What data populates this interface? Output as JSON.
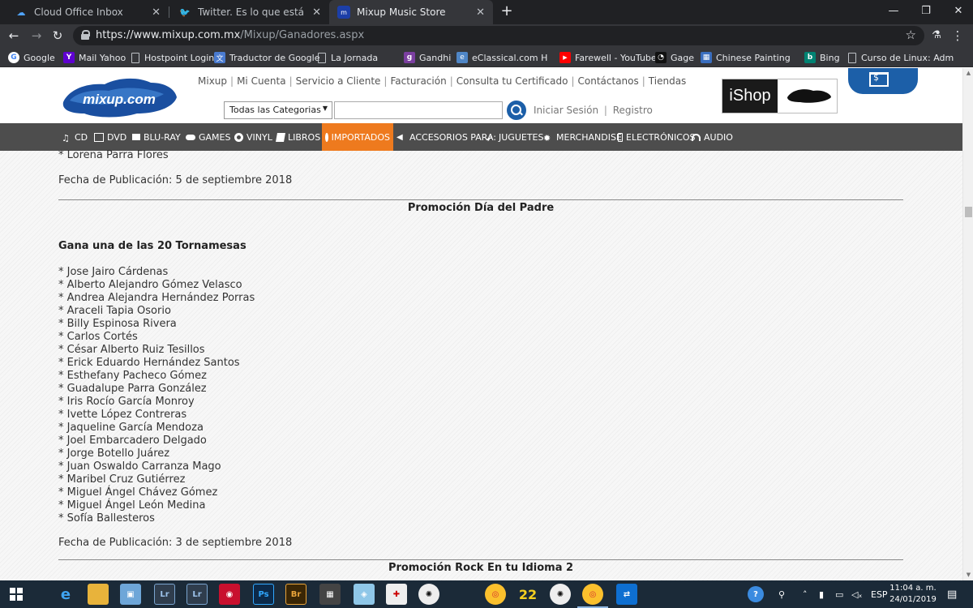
{
  "browser": {
    "tabs": [
      {
        "title": "Cloud Office Inbox",
        "icon": "cloud-icon",
        "active": false
      },
      {
        "title": "Twitter. Es lo que está pasando.",
        "icon": "twitter-icon",
        "active": false
      },
      {
        "title": "Mixup Music Store",
        "icon": "mixup-icon",
        "active": true
      }
    ],
    "url_host": "https://www.mixup.com.mx",
    "url_path": "/Mixup/Ganadores.aspx",
    "bookmarks": [
      {
        "label": "Google",
        "icon": "google-icon",
        "color": "#4285f4"
      },
      {
        "label": "Mail Yahoo",
        "icon": "yahoo-icon",
        "color": "#5f01d1"
      },
      {
        "label": "Hostpoint Login",
        "icon": "document-icon",
        "color": ""
      },
      {
        "label": "Traductor de Google",
        "icon": "translate-icon",
        "color": "#4a7bd0"
      },
      {
        "label": "La Jornada",
        "icon": "document-icon",
        "color": ""
      },
      {
        "label": "Gandhi",
        "icon": "gandhi-icon",
        "color": "#7b3fa0"
      },
      {
        "label": "eClassical.com High F",
        "icon": "eclassical-icon",
        "color": "#4f86c6"
      },
      {
        "label": "Farewell - YouTube",
        "icon": "youtube-icon",
        "color": "#ff0000"
      },
      {
        "label": "Gage",
        "icon": "gage-icon",
        "color": "#222"
      },
      {
        "label": "Chinese Painting Rice",
        "icon": "painting-icon",
        "color": "#3a6ebf"
      },
      {
        "label": "Bing",
        "icon": "bing-icon",
        "color": "#008373"
      },
      {
        "label": "Curso de Linux: Adm",
        "icon": "document-icon",
        "color": ""
      }
    ]
  },
  "site": {
    "logo_text": "mixup.com",
    "top_links": [
      "Mixup",
      "Mi Cuenta",
      "Servicio a Cliente",
      "Facturación",
      "Consulta tu Certificado",
      "Contáctanos",
      "Tiendas"
    ],
    "category_select": "Todas las Categorias",
    "search_placeholder": "",
    "login": "Iniciar Sesión",
    "register": "Registro",
    "ishop": "iShop",
    "nav": [
      {
        "label": "CD",
        "icon": "music-note-icon"
      },
      {
        "label": "DVD",
        "icon": "film-icon"
      },
      {
        "label": "BLU-RAY",
        "icon": "camera-icon"
      },
      {
        "label": "GAMES",
        "icon": "gamepad-icon"
      },
      {
        "label": "VINYL",
        "icon": "disc-icon"
      },
      {
        "label": "LIBROS",
        "icon": "book-icon"
      },
      {
        "label": "IMPORTADOS",
        "icon": "globe-icon"
      },
      {
        "label": "ACCESORIOS PARA:",
        "icon": "speaker-icon"
      },
      {
        "label": "JUGUETES",
        "icon": "rocket-icon"
      },
      {
        "label": "MERCHANDISE",
        "icon": "gear-icon"
      },
      {
        "label": "ELECTRÓNICOS",
        "icon": "phone-icon"
      },
      {
        "label": "AUDIO",
        "icon": "headphones-icon"
      }
    ]
  },
  "content": {
    "prev_last": "* Lorena Parra Flores",
    "prev_date": "Fecha de Publicación: 5 de septiembre 2018",
    "section1_title": "Promoción Día del Padre",
    "section1_subtitle": "Gana una de las 20 Tornamesas",
    "winners": [
      "* Jose Jairo Cárdenas",
      "* Alberto Alejandro Gómez Velasco",
      "* Andrea Alejandra Hernández Porras",
      "* Araceli Tapia Osorio",
      "* Billy Espinosa Rivera",
      "* Carlos Cortés",
      "* César Alberto Ruiz Tesillos",
      "* Erick Eduardo Hernández Santos",
      "* Esthefany Pacheco Gómez",
      "* Guadalupe Parra González",
      "* Iris Rocío García Monroy",
      "* Ivette López Contreras",
      "* Jaqueline García Mendoza",
      "* Joel Embarcadero Delgado",
      "* Jorge Botello Juárez",
      "* Juan Oswaldo Carranza Mago",
      "* Maribel Cruz Gutiérrez",
      "* Miguel Ángel Chávez Gómez",
      "* Miguel Ángel León Medina",
      "* Sofía Ballesteros"
    ],
    "section1_date": "Fecha de Publicación: 3 de septiembre 2018",
    "section2_title": "Promoción Rock En tu Idioma 2"
  },
  "taskbar": {
    "language": "ESP",
    "time": "11:04 a. m.",
    "date": "24/01/2019"
  },
  "colors": {
    "brand_blue": "#1c5fa8",
    "nav_gray": "#4d4d4d",
    "nav_active": "#ee7a1e"
  }
}
